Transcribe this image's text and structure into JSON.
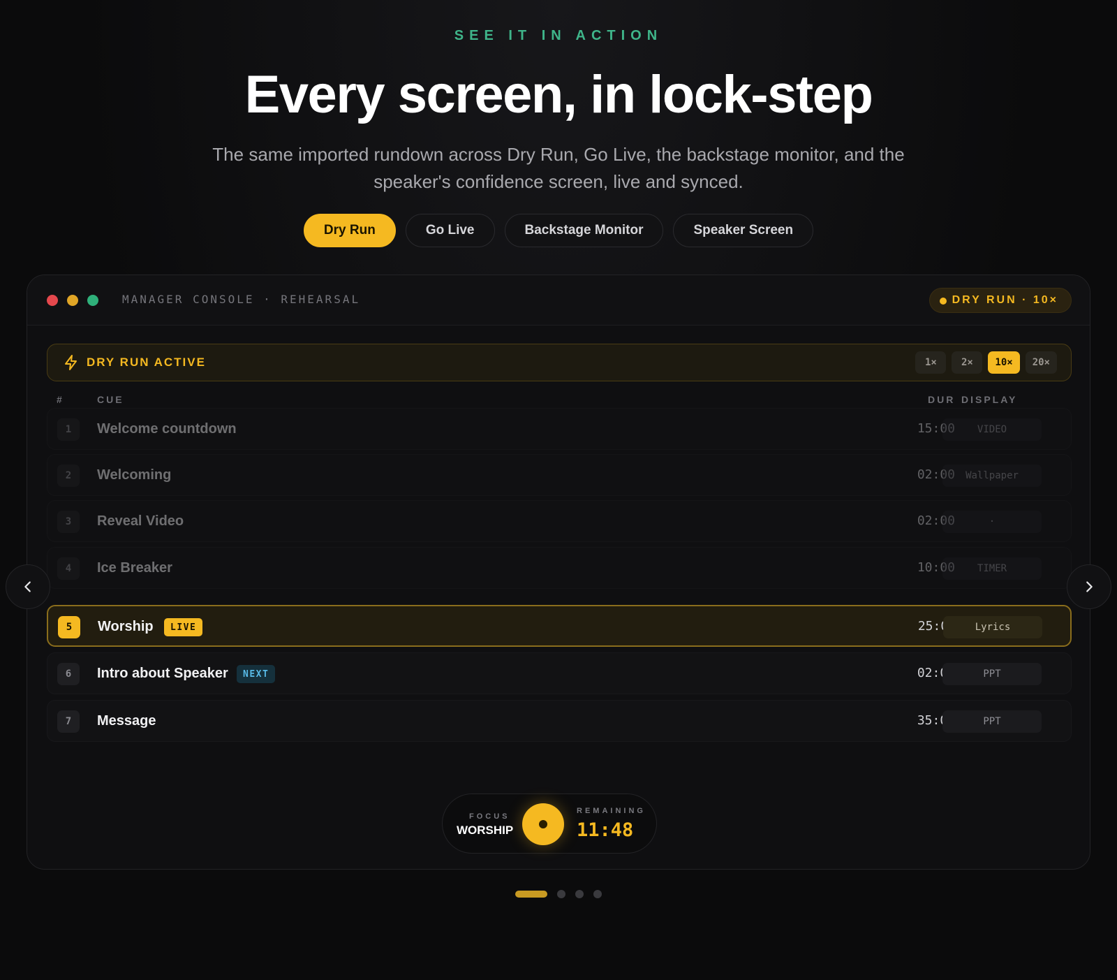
{
  "hero": {
    "eyebrow": "SEE IT IN ACTION",
    "title": "Every screen, in lock-step",
    "subtitle": "The same imported rundown across Dry Run, Go Live, the backstage monitor, and the speaker's confidence screen, live and synced."
  },
  "tabs": [
    {
      "label": "Dry Run",
      "active": true
    },
    {
      "label": "Go Live",
      "active": false
    },
    {
      "label": "Backstage Monitor",
      "active": false
    },
    {
      "label": "Speaker Screen",
      "active": false
    }
  ],
  "window": {
    "title": "MANAGER CONSOLE · REHEARSAL",
    "mode_pill": "DRY RUN · 10×"
  },
  "banner": {
    "label": "DRY RUN ACTIVE",
    "speeds": [
      "1×",
      "2×",
      "10×",
      "20×"
    ],
    "active_speed": "10×"
  },
  "table": {
    "headers": {
      "num": "#",
      "cue": "CUE",
      "dur": "DUR",
      "display": "DISPLAY"
    },
    "rows": [
      {
        "num": "1",
        "name": "Welcome countdown",
        "dur": "15:00",
        "display": "VIDEO",
        "state": "past",
        "badge": ""
      },
      {
        "num": "2",
        "name": "Welcoming",
        "dur": "02:00",
        "display": "Wallpaper",
        "state": "past",
        "badge": ""
      },
      {
        "num": "3",
        "name": "Reveal Video",
        "dur": "02:00",
        "display": "·",
        "state": "past",
        "badge": ""
      },
      {
        "num": "4",
        "name": "Ice Breaker",
        "dur": "10:00",
        "display": "TIMER",
        "state": "past",
        "badge": ""
      },
      {
        "num": "5",
        "name": "Worship",
        "dur": "25:00",
        "display": "Lyrics",
        "state": "current",
        "badge": "LIVE"
      },
      {
        "num": "6",
        "name": "Intro about Speaker",
        "dur": "02:00",
        "display": "PPT",
        "state": "next",
        "badge": "NEXT"
      },
      {
        "num": "7",
        "name": "Message",
        "dur": "35:00",
        "display": "PPT",
        "state": "upcoming",
        "badge": ""
      }
    ]
  },
  "focus": {
    "focus_label": "FOCUS",
    "focus_value": "WORSHIP",
    "remaining_label": "REMAINING",
    "remaining_value": "11:48"
  },
  "pager": {
    "count": 4,
    "active_index": 0
  },
  "colors": {
    "accent": "#f5b921",
    "eyebrow": "#3fb58a",
    "next_badge": "#58b9e6"
  }
}
